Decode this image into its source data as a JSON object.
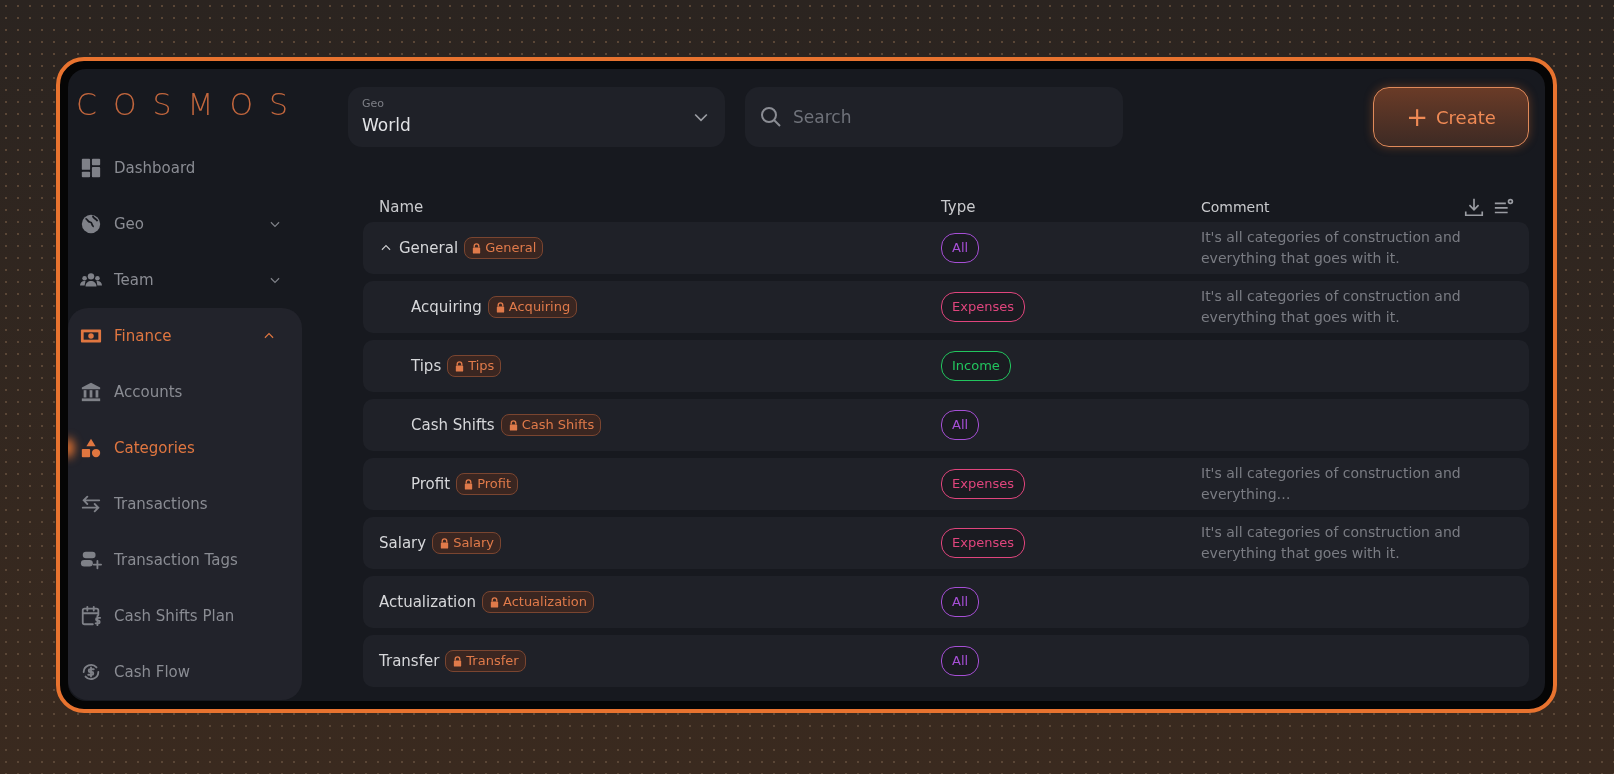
{
  "logo": "COSMOS",
  "sidebar": {
    "items": [
      {
        "label": "Dashboard",
        "selected": false
      },
      {
        "label": "Geo",
        "selected": false,
        "expanded": false
      },
      {
        "label": "Team",
        "selected": false,
        "expanded": false
      },
      {
        "label": "Finance",
        "selected": true,
        "expanded": true,
        "children": [
          {
            "label": "Accounts",
            "selected": false
          },
          {
            "label": "Categories",
            "selected": true
          },
          {
            "label": "Transactions",
            "selected": false
          },
          {
            "label": "Transaction Tags",
            "selected": false
          },
          {
            "label": "Cash Shifts Plan",
            "selected": false
          },
          {
            "label": "Cash Flow",
            "selected": false
          }
        ]
      }
    ]
  },
  "geo_select": {
    "label": "Geo",
    "value": "World"
  },
  "search": {
    "placeholder": "Search"
  },
  "create_button": {
    "icon": "+",
    "label": "Create"
  },
  "table": {
    "columns": [
      "Name",
      "Type",
      "Comment"
    ],
    "rows": [
      {
        "name": "General",
        "tag": "General",
        "type": {
          "label": "All",
          "color": "#a64fd6"
        },
        "comment": "It's all categories of construction and everything that goes with it.",
        "expanded": true,
        "children": [
          {
            "name": "Acquiring",
            "tag": "Acquiring",
            "type": {
              "label": "Expenses",
              "color": "#e0457d"
            },
            "comment": "It's all categories of construction and everything that goes with it."
          },
          {
            "name": "Tips",
            "tag": "Tips",
            "type": {
              "label": "Income",
              "color": "#22c55e"
            }
          },
          {
            "name": "Cash Shifts",
            "tag": "Cash Shifts",
            "type": {
              "label": "All",
              "color": "#a64fd6"
            }
          },
          {
            "name": "Profit",
            "tag": "Profit",
            "type": {
              "label": "Expenses",
              "color": "#e0457d"
            },
            "comment": "It's all categories of construction and everything…"
          }
        ]
      },
      {
        "name": "Salary",
        "tag": "Salary",
        "type": {
          "label": "Expenses",
          "color": "#e0457d"
        },
        "comment": "It's all categories of construction and everything that goes with it."
      },
      {
        "name": "Actualization",
        "tag": "Actualization",
        "type": {
          "label": "All",
          "color": "#a64fd6"
        }
      },
      {
        "name": "Transfer",
        "tag": "Transfer",
        "type": {
          "label": "All",
          "color": "#a64fd6"
        }
      }
    ]
  }
}
